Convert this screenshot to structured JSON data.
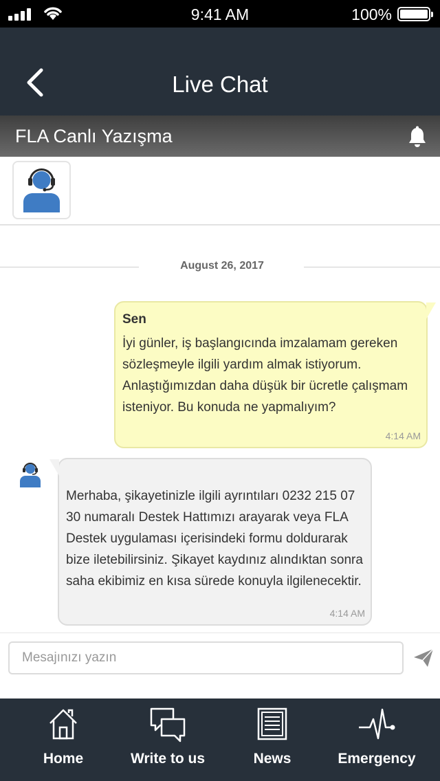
{
  "status_bar": {
    "time": "9:41 AM",
    "battery": "100%",
    "icons": [
      "signal-icon",
      "wifi-icon",
      "battery-icon"
    ]
  },
  "nav": {
    "title": "Live Chat",
    "back_icon": "chevron-left-icon"
  },
  "chat_header": {
    "title": "FLA Canlı Yazışma",
    "bell_icon": "bell-icon"
  },
  "agent": {
    "avatar_icon": "support-agent-icon"
  },
  "conversation": {
    "date": "August 26, 2017",
    "messages": [
      {
        "sender": "Sen",
        "text": "İyi günler, iş başlangıcında imzalamam gereken sözleşmeyle ilgili yardım almak istiyorum. Anlaştığımızdan daha düşük bir ücretle çalışmam isteniyor. Bu konuda ne yapmalıyım?",
        "time": "4:14 AM"
      },
      {
        "sender": "",
        "text": "Merhaba, şikayetinizle ilgili ayrıntıları 0232 215 07 30 numaralı Destek Hattımızı arayarak veya FLA Destek uygulaması içerisindeki formu doldurarak bize iletebilirsiniz. Şikayet kaydınız alındıktan sonra saha ekibimiz en kısa sürede konuyla ilgilenecektir.",
        "time": "4:14 AM"
      }
    ]
  },
  "composer": {
    "placeholder": "Mesajınızı yazın",
    "value": "",
    "send_icon": "send-icon"
  },
  "tabs": [
    {
      "label": "Home",
      "icon": "home-icon"
    },
    {
      "label": "Write to us",
      "icon": "chat-icon"
    },
    {
      "label": "News",
      "icon": "news-icon"
    },
    {
      "label": "Emergency",
      "icon": "heartbeat-icon"
    }
  ],
  "colors": {
    "nav_bg": "#27303a",
    "user_bubble": "#fcfcc4",
    "agent_bubble": "#f2f2f2",
    "agent_avatar": "#3f7cc4"
  }
}
